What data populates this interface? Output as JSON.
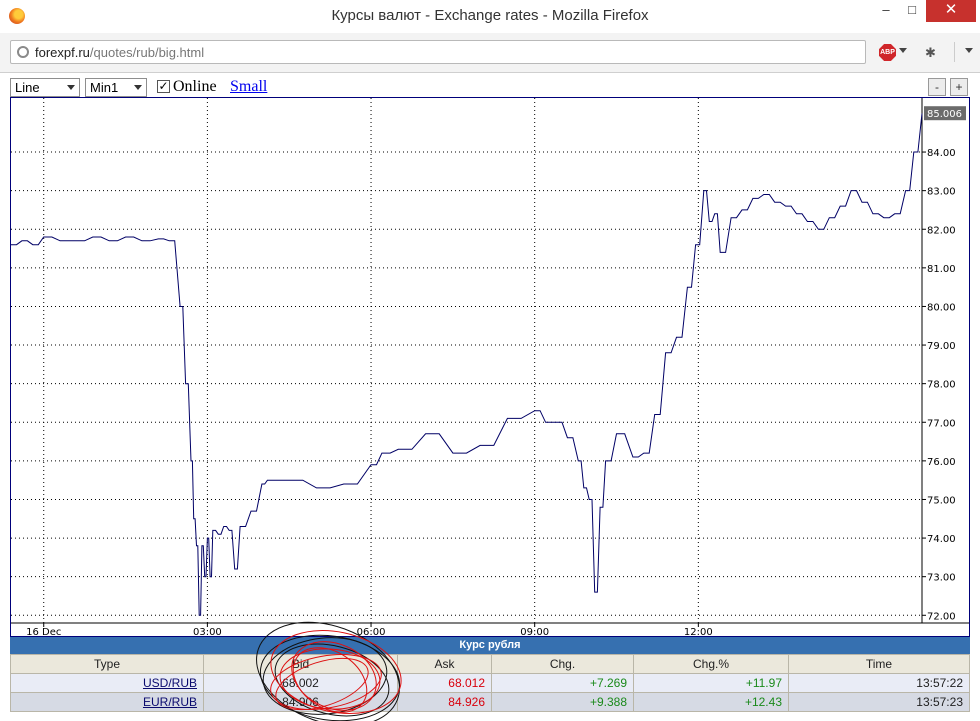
{
  "window": {
    "title": "Курсы валют - Exchange rates - Mozilla Firefox"
  },
  "address": {
    "host": "forexpf.ru",
    "path": "/quotes/rub/big.html",
    "adblock_label": "ABP"
  },
  "toolbar": {
    "chart_type": "Line",
    "timeframe": "Min1",
    "online_checked": true,
    "online_label": "Online",
    "small_link": "Small",
    "zoom_out": "-",
    "zoom_in": "+"
  },
  "chart_data": {
    "type": "line",
    "ylim": [
      71.8,
      85.4
    ],
    "yticks": [
      "72.00",
      "73.00",
      "74.00",
      "75.00",
      "76.00",
      "77.00",
      "78.00",
      "79.00",
      "80.00",
      "81.00",
      "82.00",
      "83.00",
      "84.00"
    ],
    "current_value": "85.006",
    "xticks": [
      "16 Dec",
      "03:00",
      "06:00",
      "09:00",
      "12:00"
    ],
    "x_units": "hours since 16 Dec 00:00",
    "x": [
      -0.6,
      -0.4,
      -0.2,
      0,
      0.3,
      0.6,
      0.9,
      1.2,
      1.5,
      1.8,
      2.1,
      2.3,
      2.5,
      2.6,
      2.7,
      2.75,
      2.8,
      2.85,
      2.9,
      2.95,
      3.0,
      3.05,
      3.1,
      3.2,
      3.3,
      3.4,
      3.5,
      3.6,
      3.8,
      4.0,
      4.1,
      4.2,
      4.5,
      5.0,
      5.5,
      6.0,
      6.2,
      6.5,
      7.0,
      7.5,
      8.0,
      8.5,
      9.0,
      9.2,
      9.4,
      9.6,
      9.8,
      9.9,
      10.0,
      10.1,
      10.2,
      10.3,
      10.5,
      10.8,
      11.0,
      11.2,
      11.4,
      11.6,
      11.8,
      11.95,
      12.1,
      12.2,
      12.3,
      12.4,
      12.6,
      12.8,
      13.0,
      13.2,
      13.4,
      13.6,
      13.8,
      14.0,
      14.2,
      14.4,
      14.6,
      14.8,
      15.0,
      15.2,
      15.4,
      15.6,
      15.8,
      15.95,
      16.1
    ],
    "y": [
      81.6,
      81.7,
      81.6,
      81.8,
      81.7,
      81.7,
      81.8,
      81.7,
      81.8,
      81.7,
      81.75,
      81.7,
      80.0,
      78.0,
      76.0,
      74.5,
      73.8,
      72.0,
      73.8,
      73.0,
      74.0,
      73.0,
      74.2,
      74.1,
      74.3,
      74.2,
      73.2,
      74.3,
      74.7,
      75.4,
      75.5,
      75.5,
      75.5,
      75.3,
      75.4,
      75.9,
      76.2,
      76.3,
      76.7,
      76.2,
      76.4,
      77.1,
      77.3,
      77.0,
      77.0,
      76.6,
      76.0,
      75.3,
      75.0,
      72.6,
      74.8,
      76.0,
      76.7,
      76.1,
      76.2,
      77.2,
      78.8,
      79.2,
      80.5,
      81.6,
      83.0,
      82.2,
      82.4,
      81.4,
      82.3,
      82.5,
      82.8,
      82.9,
      82.7,
      82.6,
      82.4,
      82.2,
      82.0,
      82.3,
      82.6,
      83.0,
      82.7,
      82.4,
      82.3,
      82.4,
      83.0,
      84.0,
      85.0
    ],
    "line_color": "#000066",
    "grid": "dotted"
  },
  "rates": {
    "caption": "Курс рубля",
    "headers": [
      "Type",
      "Bid",
      "Ask",
      "Chg.",
      "Chg.%",
      "Time"
    ],
    "rows": [
      {
        "type": "USD/RUB",
        "bid": "68.002",
        "ask": "68.012",
        "chg": "+7.269",
        "pct": "+11.97",
        "time": "13:57:22"
      },
      {
        "type": "EUR/RUB",
        "bid": "84.906",
        "ask": "84.926",
        "chg": "+9.388",
        "pct": "+12.43",
        "time": "13:57:23"
      }
    ]
  }
}
